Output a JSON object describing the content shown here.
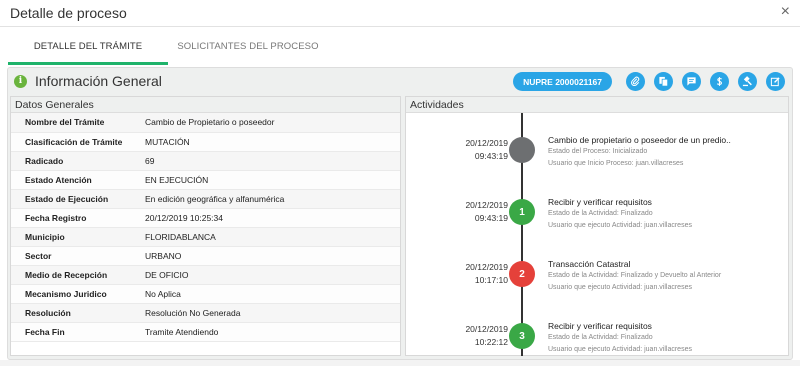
{
  "modal": {
    "title": "Detalle de proceso",
    "close": "×"
  },
  "tabs": [
    {
      "label": "DETALLE DEL TRÁMITE",
      "active": true
    },
    {
      "label": "SOLICITANTES DEL PROCESO",
      "active": false
    }
  ],
  "panel": {
    "title": "Información General",
    "info_icon": "i",
    "nupre_label": "NUPRE 2000021167",
    "action_icons": [
      "paperclip-icon",
      "copy-icon",
      "message-icon",
      "dollar-icon",
      "gavel-icon",
      "edit-icon"
    ]
  },
  "datos": {
    "title": "Datos Generales",
    "rows": [
      {
        "label": "Nombre del Trámite",
        "value": "Cambio de Propietario o poseedor"
      },
      {
        "label": "Clasificación de Trámite",
        "value": "MUTACIÓN"
      },
      {
        "label": "Radicado",
        "value": "69"
      },
      {
        "label": "Estado Atención",
        "value": "EN EJECUCIÓN"
      },
      {
        "label": "Estado de Ejecución",
        "value": "En edición geográfica y alfanumérica"
      },
      {
        "label": "Fecha Registro",
        "value": "20/12/2019 10:25:34"
      },
      {
        "label": "Municipio",
        "value": "FLORIDABLANCA"
      },
      {
        "label": "Sector",
        "value": "URBANO"
      },
      {
        "label": "Medio de Recepción",
        "value": "DE OFICIO"
      },
      {
        "label": "Mecanismo Juridico",
        "value": "No Aplica"
      },
      {
        "label": "Resolución",
        "value": "Resolución No Generada"
      },
      {
        "label": "Fecha Fin",
        "value": "Tramite Atendiendo"
      }
    ]
  },
  "actividades": {
    "title": "Actividades",
    "items": [
      {
        "date": "20/12/2019",
        "time": "09:43:19",
        "marker": "",
        "color": "#6d6f71",
        "title": "Cambio de propietario o poseedor de un predio..",
        "line1": "Estado del Proceso: Inicializado",
        "line2": "Usuario que Inicio Proceso: juan.villacreses"
      },
      {
        "date": "20/12/2019",
        "time": "09:43:19",
        "marker": "1",
        "color": "#3aa846",
        "title": "Recibir y verificar requisitos",
        "line1": "Estado de la Actividad: Finalizado",
        "line2": "Usuario que ejecuto Actividad: juan.villacreses"
      },
      {
        "date": "20/12/2019",
        "time": "10:17:10",
        "marker": "2",
        "color": "#e5413a",
        "title": "Transacción Catastral",
        "line1": "Estado de la Actividad: Finalizado y Devuelto al Anterior",
        "line2": "Usuario que ejecuto Actividad: juan.villacreses"
      },
      {
        "date": "20/12/2019",
        "time": "10:22:12",
        "marker": "3",
        "color": "#3aa846",
        "title": "Recibir y verificar requisitos",
        "line1": "Estado de la Actividad: Finalizado",
        "line2": "Usuario que ejecuto Actividad: juan.villacreses"
      }
    ]
  }
}
